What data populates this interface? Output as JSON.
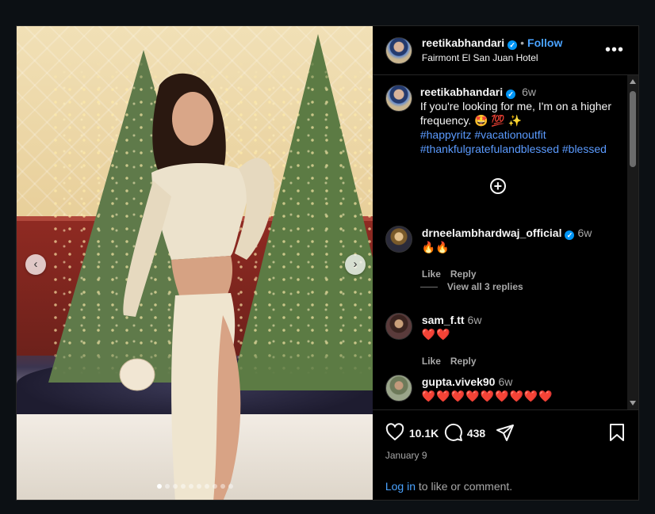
{
  "post": {
    "username": "reetikabhandari",
    "verified_mark": "✓",
    "bullet": "•",
    "follow_label": "Follow",
    "location": "Fairmont El San Juan Hotel",
    "more_icon": "more-horizontal-icon"
  },
  "media": {
    "prev_icon": "chevron-left-icon",
    "next_icon": "chevron-right-icon",
    "prev_glyph": "‹",
    "next_glyph": "›",
    "slide_count": 10,
    "active_slide": 1
  },
  "caption": {
    "username": "reetikabhandari",
    "time": "6w",
    "text": "If you're looking for me, I'm on a higher frequency. 🤩 💯  ✨",
    "hashtags_line1": "#happyritz #vacationoutfit",
    "hashtags_line2": "#thankfulgratefulandblessed #blessed"
  },
  "load_more_glyph": "+",
  "comments": [
    {
      "username": "drneelambhardwaj_official",
      "verified": true,
      "time": "6w",
      "text": "🔥🔥",
      "like_label": "Like",
      "reply_label": "Reply",
      "view_replies": "View all 3 replies"
    },
    {
      "username": "sam_f.tt",
      "time": "6w",
      "text": "❤️❤️",
      "like_label": "Like",
      "reply_label": "Reply"
    },
    {
      "username": "gupta.vivek90",
      "time": "6w",
      "text": "❤️❤️❤️❤️❤️❤️❤️❤️❤️"
    }
  ],
  "actions": {
    "like_icon": "heart-icon",
    "comment_icon": "comment-icon",
    "share_icon": "send-icon",
    "save_icon": "bookmark-icon",
    "like_count": "10.1K",
    "comment_count": "438",
    "date": "January 9"
  },
  "login": {
    "link_text": "Log in",
    "rest_text": " to like or comment."
  },
  "colors": {
    "background": "#0c1014",
    "panel": "#000000",
    "link_blue": "#4aa3ff",
    "hashtag_blue": "#5b9bff",
    "verified_blue": "#0095f6",
    "heart_red": "#ff3040"
  }
}
